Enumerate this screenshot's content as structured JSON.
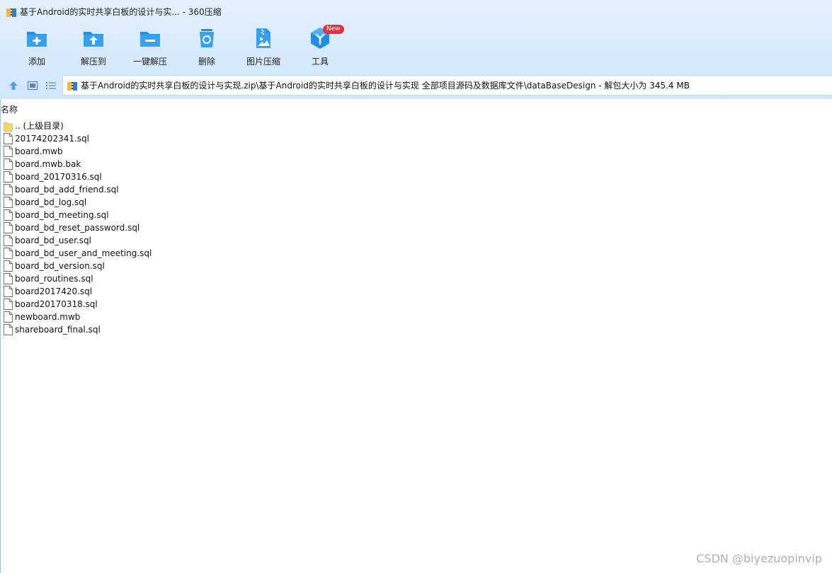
{
  "window": {
    "title": "基于Android的实时共享白板的设计与实... - 360压缩",
    "app_icon": "archive-app-icon"
  },
  "toolbar": {
    "buttons": [
      {
        "label": "添加",
        "icon": "add-folder-icon"
      },
      {
        "label": "解压到",
        "icon": "extract-to-icon"
      },
      {
        "label": "一键解压",
        "icon": "one-click-extract-icon"
      },
      {
        "label": "删除",
        "icon": "delete-trash-icon"
      },
      {
        "label": "图片压缩",
        "icon": "image-compress-icon"
      },
      {
        "label": "工具",
        "icon": "tools-cube-icon",
        "badge": "New"
      }
    ]
  },
  "navbar": {
    "up_icon": "up-arrow-icon",
    "view_icon": "thumbnail-view-icon",
    "list_icon": "list-view-icon",
    "address": "基于Android的实时共享白板的设计与实现.zip\\基于Android的实时共享白板的设计与实现 全部项目源码及数据库文件\\dataBaseDesign - 解包大小为 345.4 MB"
  },
  "list": {
    "column_name": "名称",
    "items": [
      {
        "name": ".. (上级目录)",
        "type": "folder"
      },
      {
        "name": "20174202341.sql",
        "type": "file"
      },
      {
        "name": "board.mwb",
        "type": "file"
      },
      {
        "name": "board.mwb.bak",
        "type": "file"
      },
      {
        "name": "board_20170316.sql",
        "type": "file"
      },
      {
        "name": "board_bd_add_friend.sql",
        "type": "file"
      },
      {
        "name": "board_bd_log.sql",
        "type": "file"
      },
      {
        "name": "board_bd_meeting.sql",
        "type": "file"
      },
      {
        "name": "board_bd_reset_password.sql",
        "type": "file"
      },
      {
        "name": "board_bd_user.sql",
        "type": "file"
      },
      {
        "name": "board_bd_user_and_meeting.sql",
        "type": "file"
      },
      {
        "name": "board_bd_version.sql",
        "type": "file"
      },
      {
        "name": "board_routines.sql",
        "type": "file"
      },
      {
        "name": "board2017420.sql",
        "type": "file"
      },
      {
        "name": "board20170318.sql",
        "type": "file"
      },
      {
        "name": "newboard.mwb",
        "type": "file"
      },
      {
        "name": "shareboard_final.sql",
        "type": "file"
      }
    ]
  },
  "watermark": "CSDN @biyezuopinvip",
  "colors": {
    "toolbar_bg": "#d7eafc",
    "icon_blue": "#1e8fe8",
    "badge_red": "#ec2d3a",
    "folder_yellow": "#f7d468"
  }
}
